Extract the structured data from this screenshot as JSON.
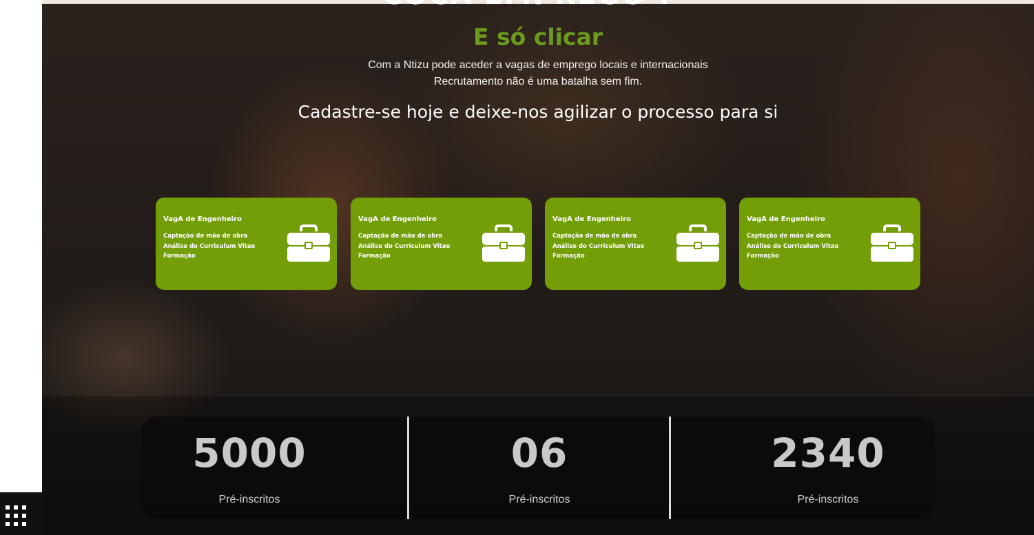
{
  "hero": {
    "title_partial": "COCA EMPREGO ?",
    "accent_title": "E só clicar",
    "subtitle_line1": "Com a Ntizu pode aceder a vagas de emprego locais e internacionais",
    "subtitle_line2": "Recrutamento não é uma batalha sem fim.",
    "cta": "Cadastre-se hoje e deixe-nos agilizar o processo para si"
  },
  "cards": [
    {
      "title": "VagA de Engenheiro",
      "lines": [
        "Captação de mão de obra",
        "Análise do Curriculum Vitae",
        "Formação"
      ],
      "icon": "briefcase-icon"
    },
    {
      "title": "VagA de Engenheiro",
      "lines": [
        "Captação de mão de obra",
        "Análise do Curriculum Vitae",
        "Formação"
      ],
      "icon": "briefcase-icon"
    },
    {
      "title": "VagA de Engenheiro",
      "lines": [
        "Captação de mão de obra",
        "Análise do Curriculum Vitae",
        "Formação"
      ],
      "icon": "briefcase-icon"
    },
    {
      "title": "VagA de Engenheiro",
      "lines": [
        "Captação de mão de obra",
        "Análise do Curriculum Vitae",
        "Formação"
      ],
      "icon": "briefcase-icon"
    }
  ],
  "stats": [
    {
      "value": "5000",
      "label": "Pré-inscritos"
    },
    {
      "value": "06",
      "label": "Pré-inscritos"
    },
    {
      "value": "2340",
      "label": "Pré-inscritos"
    }
  ],
  "colors": {
    "accent": "#6b9a1c",
    "card_bg": "#739e08",
    "stat_text": "#c9c9c9"
  },
  "widgets": {
    "menu_icon": "grid-dots-icon"
  }
}
